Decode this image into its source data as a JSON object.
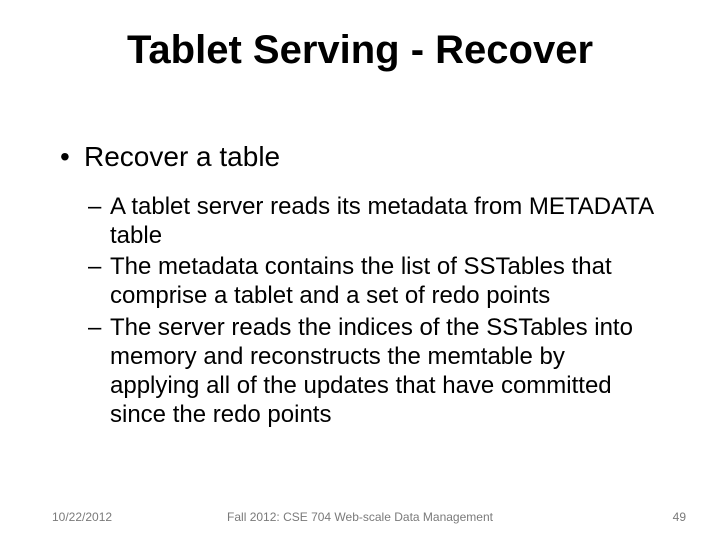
{
  "title": "Tablet Serving - Recover",
  "bullets": {
    "l1": "Recover a table",
    "l2a": "A tablet server reads its metadata from METADATA table",
    "l2b": "The metadata contains the list of SSTables that comprise a tablet and a set of redo points",
    "l2c": "The server reads the indices of the SSTables into memory and reconstructs the memtable by applying all of the updates that have committed since the redo points"
  },
  "footer": {
    "date": "10/22/2012",
    "center": "Fall 2012: CSE 704 Web-scale Data Management",
    "page": "49"
  }
}
